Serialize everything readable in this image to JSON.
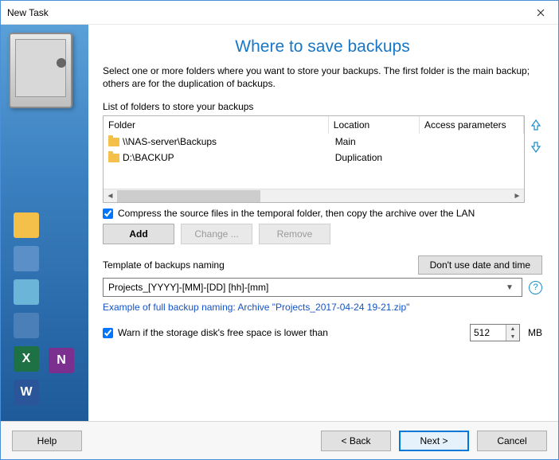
{
  "window": {
    "title": "New Task"
  },
  "heading": "Where to save backups",
  "description": "Select one or more folders where you want to store your backups. The first folder is the main backup; others are for the duplication of backups.",
  "list_label": "List of folders to store your backups",
  "table": {
    "headers": {
      "folder": "Folder",
      "location": "Location",
      "access": "Access parameters"
    },
    "rows": [
      {
        "folder": "\\\\NAS-server\\Backups",
        "location": "Main",
        "access": ""
      },
      {
        "folder": "D:\\BACKUP",
        "location": "Duplication",
        "access": ""
      }
    ]
  },
  "compress": {
    "checked": true,
    "label": "Compress the source files in the temporal folder, then copy the archive over the LAN"
  },
  "buttons": {
    "add": "Add",
    "change": "Change ...",
    "remove": "Remove",
    "no_date": "Don't use date and time"
  },
  "template": {
    "label": "Template of backups naming",
    "value": "Projects_[YYYY]-[MM]-[DD] [hh]-[mm]"
  },
  "example": "Example of full backup naming: Archive \"Projects_2017-04-24 19-21.zip\"",
  "warn": {
    "checked": true,
    "label": "Warn if the storage disk's free space is lower than",
    "value": "512",
    "unit": "MB"
  },
  "footer": {
    "help": "Help",
    "back": "< Back",
    "next": "Next >",
    "cancel": "Cancel"
  }
}
